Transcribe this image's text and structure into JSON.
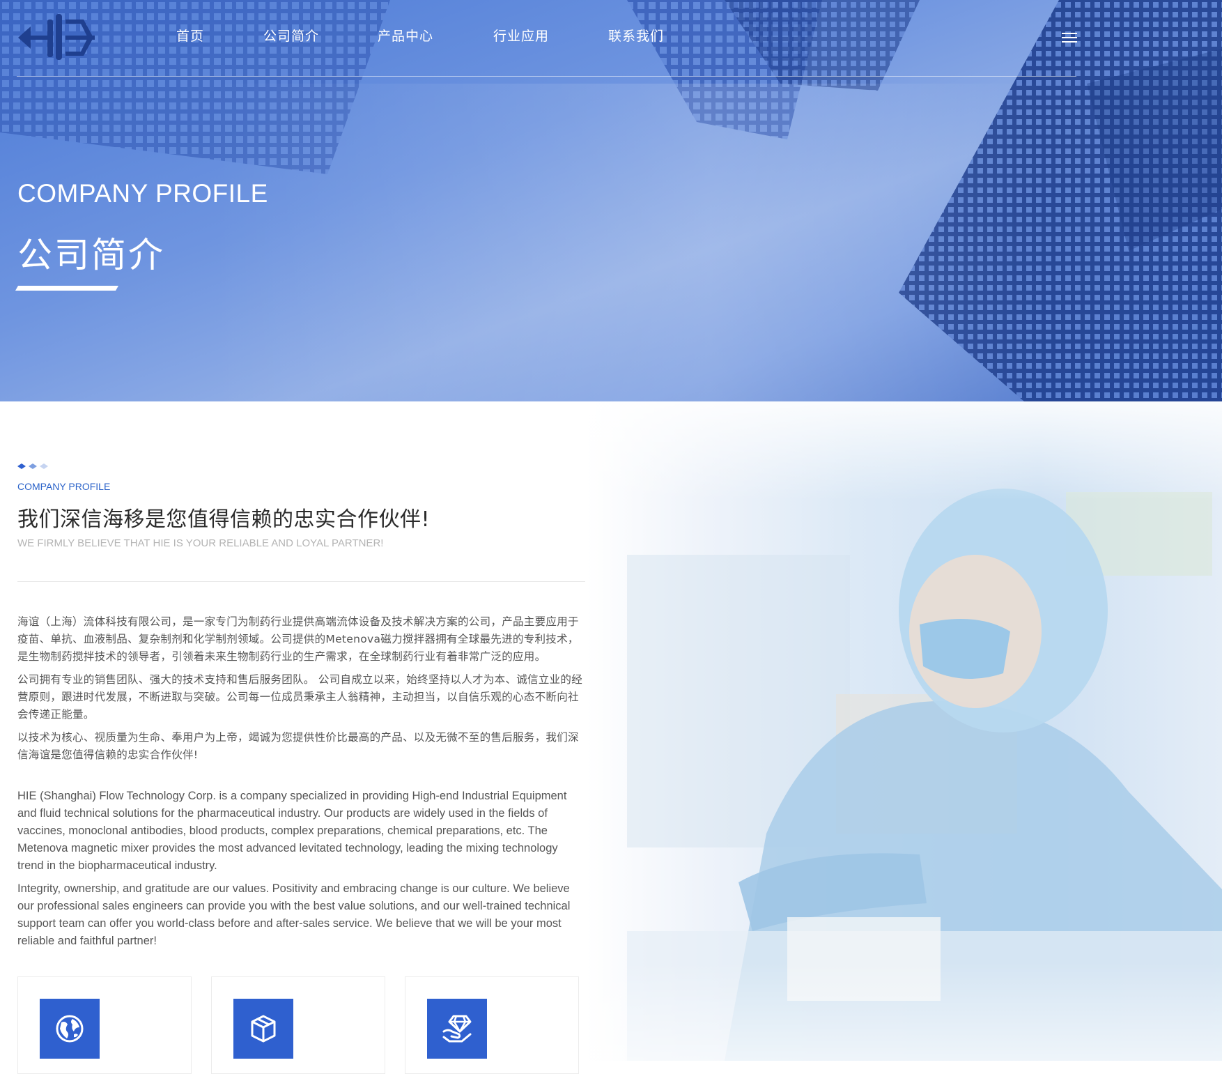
{
  "header": {
    "logo_text": "HIE",
    "nav": [
      {
        "label": "首页"
      },
      {
        "label": "公司简介"
      },
      {
        "label": "产品中心"
      },
      {
        "label": "行业应用"
      },
      {
        "label": "联系我们"
      }
    ],
    "menu_icon": "hamburger-menu-icon"
  },
  "hero": {
    "title_en": "COMPANY PROFILE",
    "title_cn": "公司简介"
  },
  "about": {
    "label": "COMPANY PROFILE",
    "title": "我们深信海移是您值得信赖的忠实合作伙伴!",
    "subtitle": "WE FIRMLY BELIEVE THAT HIE IS YOUR RELIABLE AND LOYAL PARTNER!",
    "paragraphs_cn": [
      "海谊（上海）流体科技有限公司，是一家专门为制药行业提供高端流体设备及技术解决方案的公司，产品主要应用于疫苗、单抗、血液制品、复杂制剂和化学制剂领域。公司提供的Metenova磁力搅拌器拥有全球最先进的专利技术，是生物制药搅拌技术的领导者，引领着未来生物制药行业的生产需求，在全球制药行业有着非常广泛的应用。",
      "公司拥有专业的销售团队、强大的技术支持和售后服务团队。 公司自成立以来，始终坚持以人才为本、诚信立业的经营原则，跟进时代发展，不断进取与突破。公司每一位成员秉承主人翁精神，主动担当，以自信乐观的心态不断向社会传递正能量。",
      "以技术为核心、视质量为生命、奉用户为上帝，竭诚为您提供性价比最高的产品、以及无微不至的售后服务，我们深信海谊是您值得信赖的忠实合作伙伴!"
    ],
    "paragraphs_en": [
      "HIE (Shanghai) Flow Technology Corp. is a company specialized in providing High-end Industrial Equipment and fluid technical solutions for the pharmaceutical industry. Our products are widely used in the fields of vaccines, monoclonal antibodies, blood products, complex preparations, chemical preparations, etc. The Metenova magnetic mixer provides the most advanced levitated technology, leading the mixing technology trend in the biopharmaceutical industry.",
      "Integrity, ownership, and gratitude are our values. Positivity and embracing change is our culture. We believe our professional sales engineers can provide you with the best value solutions, and our well-trained technical support team can offer you world-class before and after-sales service. We believe that we will be your most reliable and faithful partner!"
    ]
  },
  "cards": [
    {
      "icon": "globe-icon"
    },
    {
      "icon": "cube-icon"
    },
    {
      "icon": "diamond-hand-icon"
    }
  ],
  "colors": {
    "accent": "#2f60cf",
    "hero_blue": "#4a79d6",
    "label_blue": "#2a62c9",
    "text_dark": "#2b2b2b",
    "text_body": "#555555",
    "text_muted": "#b4b4b4"
  }
}
